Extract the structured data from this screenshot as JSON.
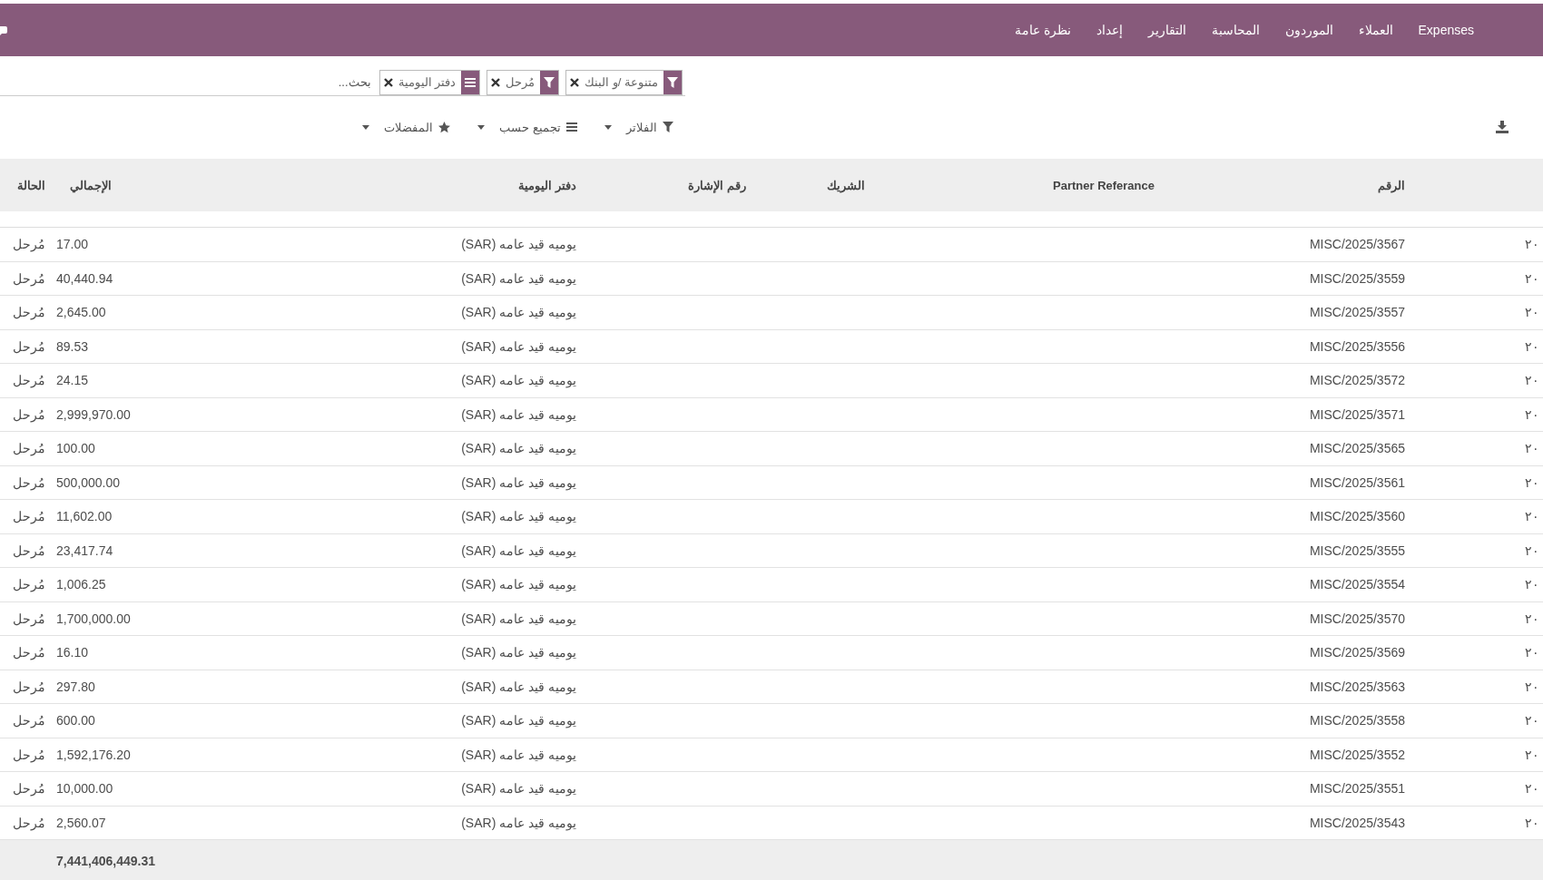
{
  "menu": {
    "items": [
      "Expenses",
      "العملاء",
      "الموردون",
      "المحاسبة",
      "التقارير",
      "إعداد",
      "نظرة عامة"
    ]
  },
  "search": {
    "facets": [
      {
        "kind": "filter",
        "label": "متنوعة /و البنك"
      },
      {
        "kind": "filter",
        "label": "مُرحل"
      },
      {
        "kind": "group",
        "label": "دفتر اليومية"
      }
    ],
    "placeholder": "بحث..."
  },
  "controls": [
    {
      "kind": "filter",
      "label": "الفلاتر"
    },
    {
      "kind": "group",
      "label": "تجميع حسب"
    },
    {
      "kind": "favorite",
      "label": "المفضلات"
    }
  ],
  "table": {
    "columns": [
      "الرقم",
      "Partner Referance",
      "الشريك",
      "رقم الإشارة",
      "دفتر اليومية",
      "الإجمالي",
      "الحالة"
    ],
    "rows": [
      {
        "column_1": "٢٠",
        "number": "MISC/2025/3567",
        "journal": "يوميه قيد عامه (SAR)",
        "total": "17.00",
        "status": "مُرحل"
      },
      {
        "column_1": "٢٠",
        "number": "MISC/2025/3559",
        "journal": "يوميه قيد عامه (SAR)",
        "total": "40,440.94",
        "status": "مُرحل"
      },
      {
        "column_1": "٢٠",
        "number": "MISC/2025/3557",
        "journal": "يوميه قيد عامه (SAR)",
        "total": "2,645.00",
        "status": "مُرحل"
      },
      {
        "column_1": "٢٠",
        "number": "MISC/2025/3556",
        "journal": "يوميه قيد عامه (SAR)",
        "total": "89.53",
        "status": "مُرحل"
      },
      {
        "column_1": "٢٠",
        "number": "MISC/2025/3572",
        "journal": "يوميه قيد عامه (SAR)",
        "total": "24.15",
        "status": "مُرحل"
      },
      {
        "column_1": "٢٠",
        "number": "MISC/2025/3571",
        "journal": "يوميه قيد عامه (SAR)",
        "total": "2,999,970.00",
        "status": "مُرحل"
      },
      {
        "column_1": "٢٠",
        "number": "MISC/2025/3565",
        "journal": "يوميه قيد عامه (SAR)",
        "total": "100.00",
        "status": "مُرحل"
      },
      {
        "column_1": "٢٠",
        "number": "MISC/2025/3561",
        "journal": "يوميه قيد عامه (SAR)",
        "total": "500,000.00",
        "status": "مُرحل"
      },
      {
        "column_1": "٢٠",
        "number": "MISC/2025/3560",
        "journal": "يوميه قيد عامه (SAR)",
        "total": "11,602.00",
        "status": "مُرحل"
      },
      {
        "column_1": "٢٠",
        "number": "MISC/2025/3555",
        "journal": "يوميه قيد عامه (SAR)",
        "total": "23,417.74",
        "status": "مُرحل"
      },
      {
        "column_1": "٢٠",
        "number": "MISC/2025/3554",
        "journal": "يوميه قيد عامه (SAR)",
        "total": "1,006.25",
        "status": "مُرحل"
      },
      {
        "column_1": "٢٠",
        "number": "MISC/2025/3570",
        "journal": "يوميه قيد عامه (SAR)",
        "total": "1,700,000.00",
        "status": "مُرحل"
      },
      {
        "column_1": "٢٠",
        "number": "MISC/2025/3569",
        "journal": "يوميه قيد عامه (SAR)",
        "total": "16.10",
        "status": "مُرحل"
      },
      {
        "column_1": "٢٠",
        "number": "MISC/2025/3563",
        "journal": "يوميه قيد عامه (SAR)",
        "total": "297.80",
        "status": "مُرحل"
      },
      {
        "column_1": "٢٠",
        "number": "MISC/2025/3558",
        "journal": "يوميه قيد عامه (SAR)",
        "total": "600.00",
        "status": "مُرحل"
      },
      {
        "column_1": "٢٠",
        "number": "MISC/2025/3552",
        "journal": "يوميه قيد عامه (SAR)",
        "total": "1,592,176.20",
        "status": "مُرحل"
      },
      {
        "column_1": "٢٠",
        "number": "MISC/2025/3551",
        "journal": "يوميه قيد عامه (SAR)",
        "total": "10,000.00",
        "status": "مُرحل"
      },
      {
        "column_1": "٢٠",
        "number": "MISC/2025/3543",
        "journal": "يوميه قيد عامه (SAR)",
        "total": "2,560.07",
        "status": "مُرحل"
      }
    ],
    "footer_total": "7,441,406,449.31"
  }
}
